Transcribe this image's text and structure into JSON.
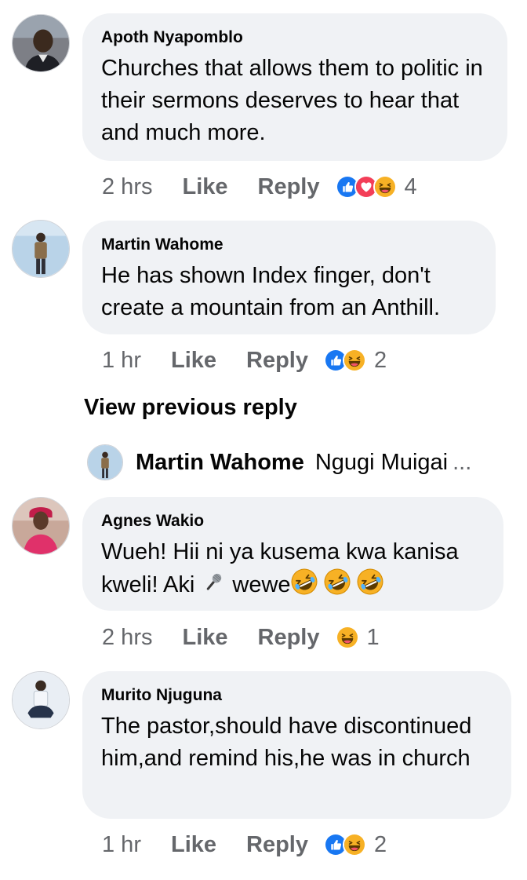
{
  "comments": [
    {
      "author": "Apoth Nyapomblo",
      "text": "Churches that allows them to politic in their sermons deserves to hear that and much more.",
      "time": "2 hrs",
      "like": "Like",
      "reply": "Reply",
      "reactions": [
        "like-reaction-icon",
        "love-reaction-icon",
        "haha-reaction-icon"
      ],
      "reaction_count": "4"
    },
    {
      "author": "Martin Wahome",
      "text": "He has shown Index finger, don't create a mountain from an Anthill.",
      "time": "1 hr",
      "like": "Like",
      "reply": "Reply",
      "reactions": [
        "like-reaction-icon",
        "haha-reaction-icon"
      ],
      "reaction_count": "2"
    },
    {
      "author": "Agnes Wakio",
      "text_before": "Wueh! Hii ni ya kusema kwa kanisa kweli! Aki ",
      "text_middle": " wewe",
      "inline_emojis": [
        "microphone-emoji",
        "rofl-emoji",
        "rofl-emoji",
        "rofl-emoji"
      ],
      "time": "2 hrs",
      "like": "Like",
      "reply": "Reply",
      "reactions": [
        "haha-reaction-icon"
      ],
      "reaction_count": "1"
    },
    {
      "author": "Murito Njuguna",
      "text": "The pastor,should have discontinued him,and remind his,he was in church",
      "time": "1 hr",
      "like": "Like",
      "reply": "Reply",
      "reactions": [
        "like-reaction-icon",
        "haha-reaction-icon"
      ],
      "reaction_count": "2"
    }
  ],
  "view_previous": "View previous reply",
  "reply_preview": {
    "author": "Martin Wahome",
    "text": "Ngugi Muigai",
    "ellipsis": "..."
  },
  "colors": {
    "bubble": "#f0f2f5",
    "meta_text": "#65676b",
    "like_blue": "#1877f2",
    "love_red": "#f33e58",
    "haha_yellow": "#f7b125"
  }
}
